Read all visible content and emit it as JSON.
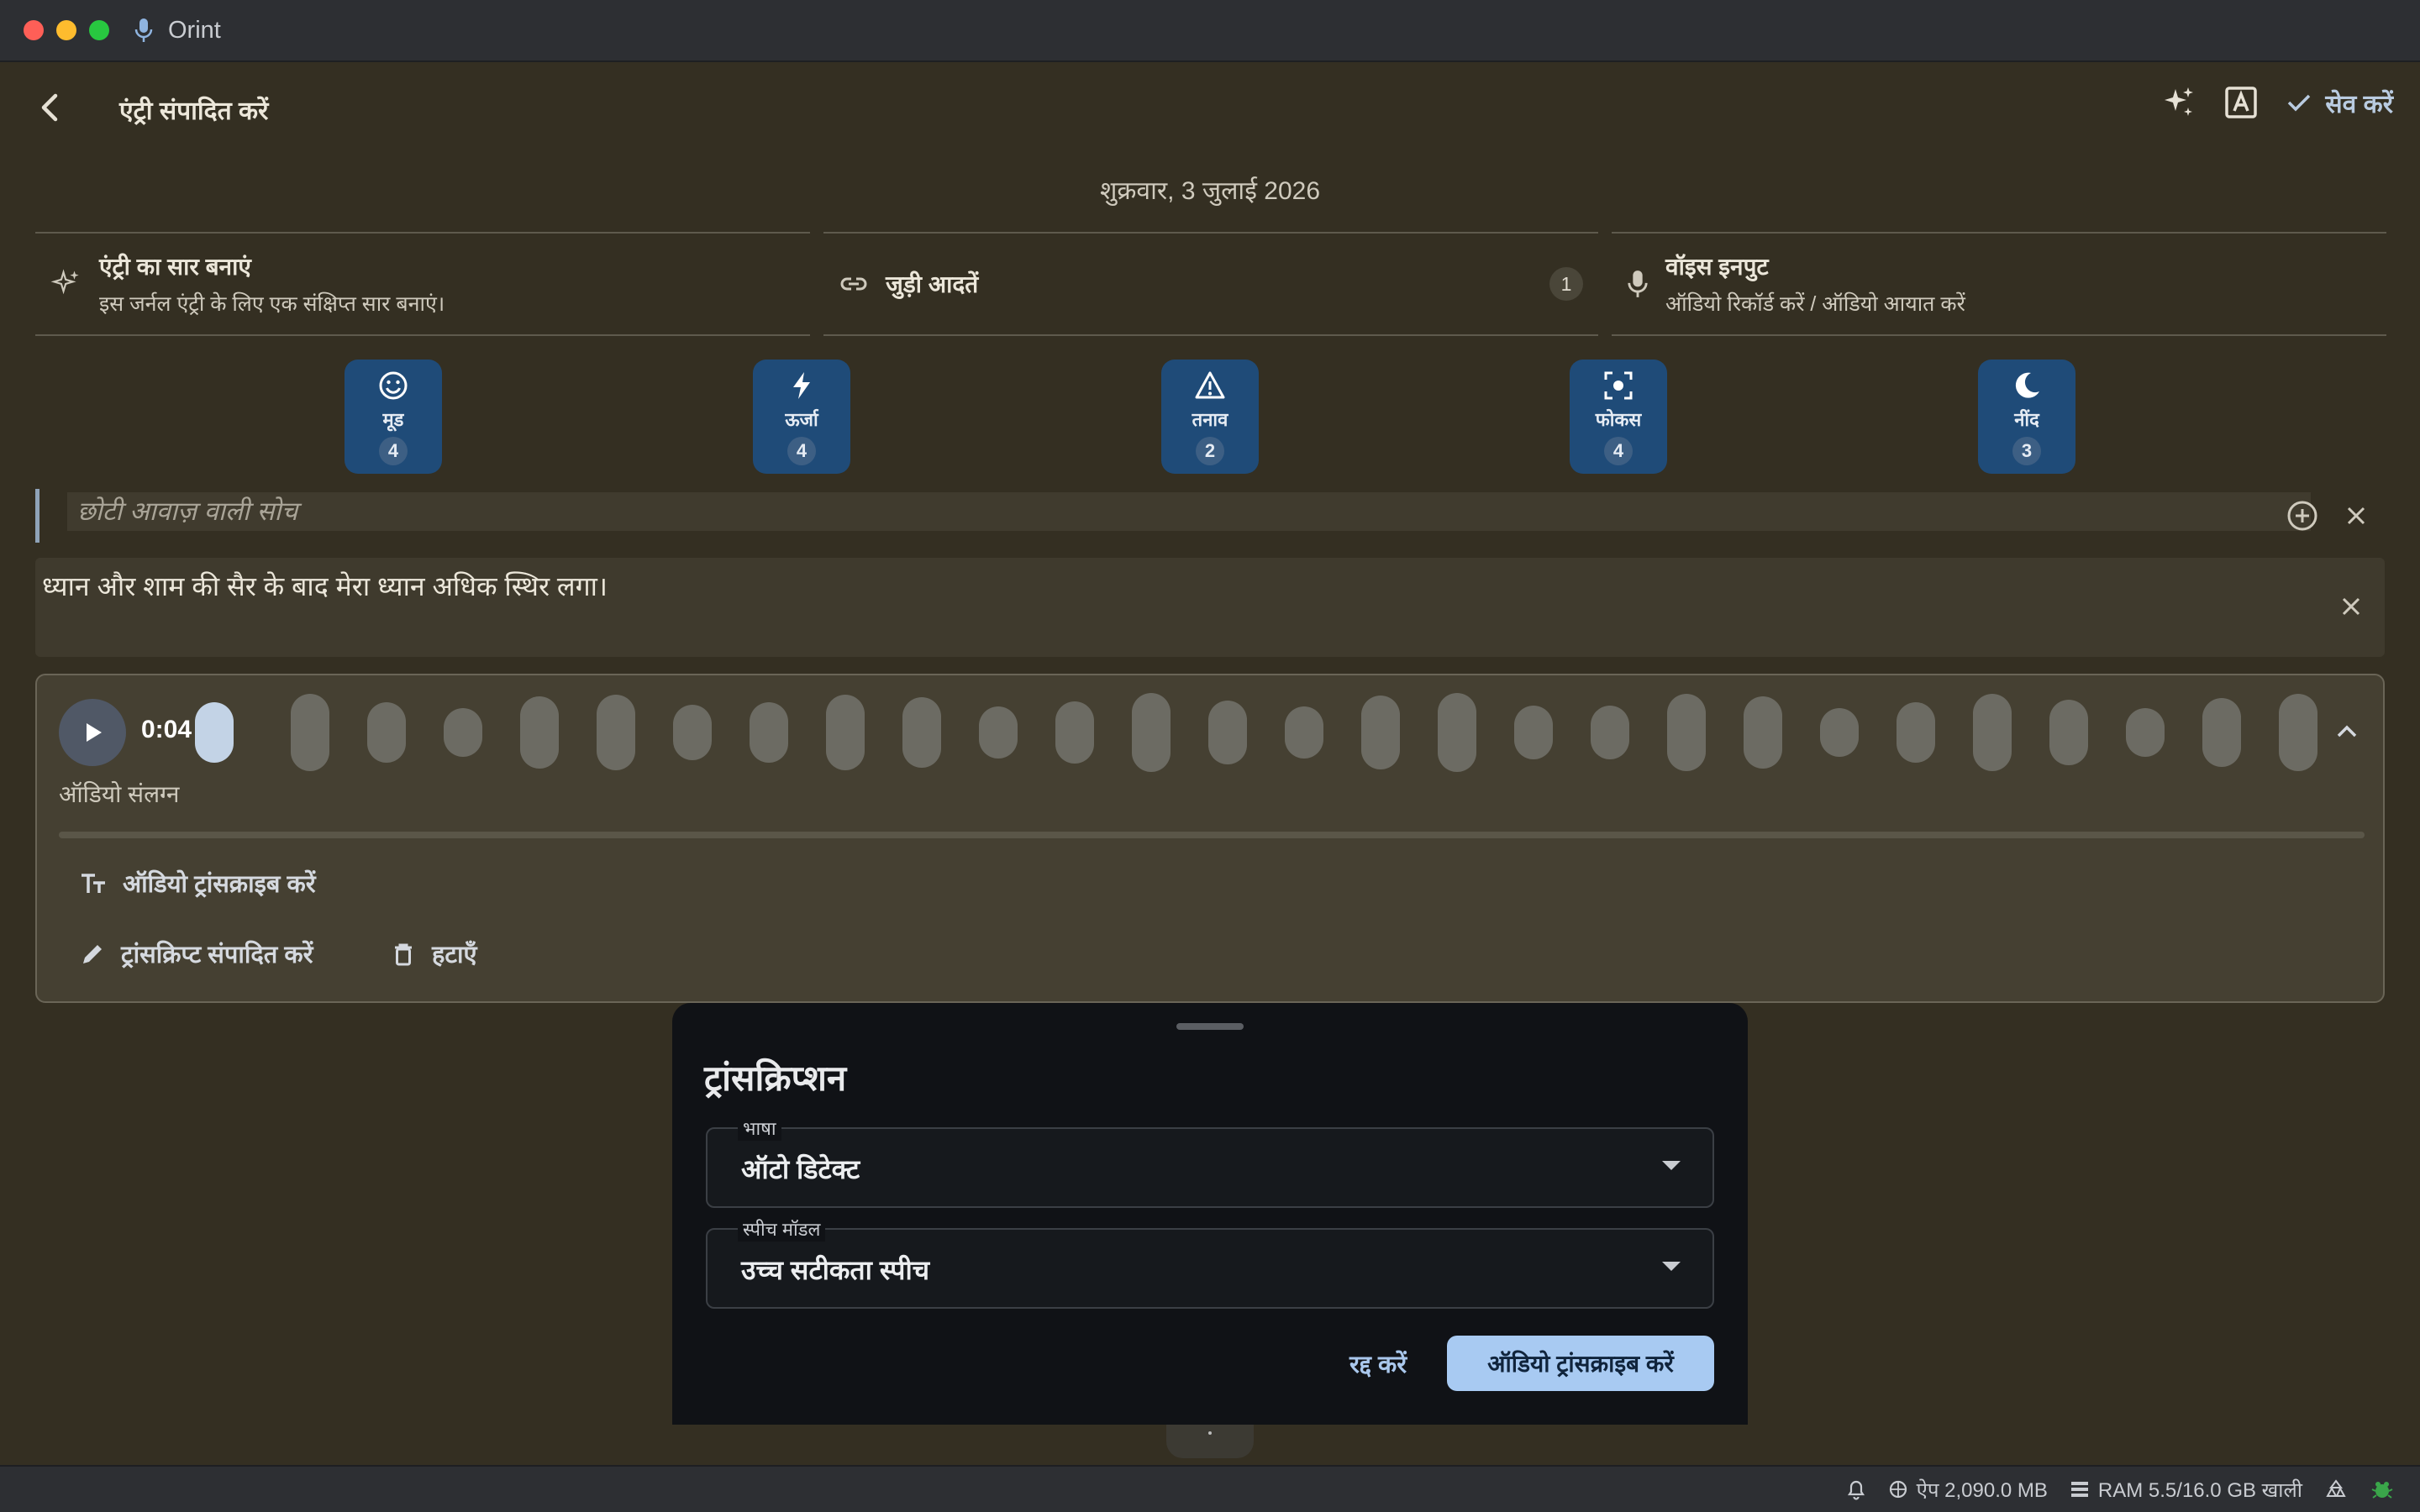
{
  "window": {
    "app_name": "Orint"
  },
  "appbar": {
    "title": "एंट्री संपादित करें",
    "save_label": "सेव करें"
  },
  "date": "शुक्रवार, 3 जुलाई 2026",
  "cards": {
    "summary": {
      "title": "एंट्री का सार बनाएं",
      "subtitle": "इस जर्नल एंट्री के लिए एक संक्षिप्त सार बनाएं।"
    },
    "habits": {
      "title": "जुड़ी आदतें",
      "count": "1"
    },
    "voice": {
      "title": "वॉइस इनपुट",
      "subtitle": "ऑडियो रिकॉर्ड करें / ऑडियो आयात करें"
    }
  },
  "metrics": [
    {
      "label": "मूड",
      "value": "4",
      "icon": "smile-icon"
    },
    {
      "label": "ऊर्जा",
      "value": "4",
      "icon": "bolt-icon"
    },
    {
      "label": "तनाव",
      "value": "2",
      "icon": "warning-icon"
    },
    {
      "label": "फोकस",
      "value": "4",
      "icon": "focus-icon"
    },
    {
      "label": "नींद",
      "value": "3",
      "icon": "moon-icon"
    }
  ],
  "entry": {
    "title_placeholder": "छोटी आवाज़ वाली सोच",
    "body": "ध्यान और शाम की सैर के बाद मेरा ध्यान अधिक स्थिर लगा।"
  },
  "audio": {
    "time": "0:04",
    "label": "ऑडियो संलग्न",
    "progress": 0.0,
    "transcribe_label": "ऑडियो ट्रांसक्राइब करें",
    "edit_transcript_label": "ट्रांसक्रिप्ट संपादित करें",
    "delete_label": "हटाएँ"
  },
  "sheet": {
    "title": "ट्रांसक्रिप्शन",
    "language_label": "भाषा",
    "language_value": "ऑटो डिटेक्ट",
    "model_label": "स्पीच मॉडल",
    "model_value": "उच्च सटीकता स्पीच",
    "cancel_label": "रद्द करें",
    "confirm_label": "ऑडियो ट्रांसक्राइब करें"
  },
  "statusbar": {
    "app_memory": "ऐप 2,090.0 MB",
    "ram": "RAM 5.5/16.0 GB खाली"
  },
  "colors": {
    "accent": "#a8caf2",
    "metric_bg": "#1f4b78",
    "background": "#342f22"
  }
}
